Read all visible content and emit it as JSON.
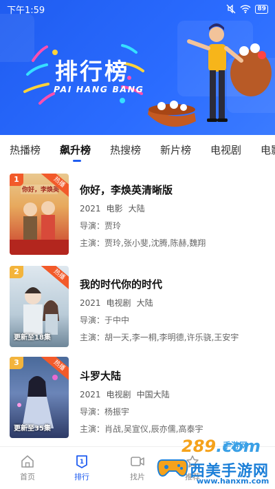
{
  "status_bar": {
    "time": "下午1:59",
    "battery": "89"
  },
  "banner": {
    "title": "排行榜",
    "subtitle": "PAI HANG BANG"
  },
  "tabs": [
    {
      "label": "热播榜"
    },
    {
      "label": "飙升榜",
      "active": true
    },
    {
      "label": "热搜榜"
    },
    {
      "label": "新片榜"
    },
    {
      "label": "电视剧"
    },
    {
      "label": "电影"
    }
  ],
  "items": [
    {
      "rank": "1",
      "badge": "热播",
      "rank_color": "#f25a2a",
      "poster_text": "你好，李焕英",
      "title": "你好，李焕英清晰版",
      "year": "2021",
      "type": "电影",
      "region": "大陆",
      "director_label": "导演：",
      "director": "贾玲",
      "cast_label": "主演：",
      "cast": "贾玲,张小斐,沈腾,陈赫,魏翔"
    },
    {
      "rank": "2",
      "badge": "热播",
      "rank_color": "#f3b43c",
      "poster_text": "更新至18集",
      "title": "我的时代你的时代",
      "year": "2021",
      "type": "电视剧",
      "region": "大陆",
      "director_label": "导演：",
      "director": "于中中",
      "cast_label": "主演：",
      "cast": "胡一天,李一桐,李明德,许乐骁,王安宇"
    },
    {
      "rank": "3",
      "badge": "热播",
      "rank_color": "#f3b43c",
      "poster_text": "更新至35集",
      "title": "斗罗大陆",
      "year": "2021",
      "type": "电视剧",
      "region": "中国大陆",
      "director_label": "导演：",
      "director": "杨振宇",
      "cast_label": "主演：",
      "cast": "肖战,吴宣仪,辰亦儒,高泰宇"
    }
  ],
  "bottom_nav": [
    {
      "label": "首页",
      "icon": "home-icon"
    },
    {
      "label": "排行",
      "icon": "ranking-icon",
      "active": true
    },
    {
      "label": "找片",
      "icon": "video-icon"
    },
    {
      "label": "推荐",
      "icon": "recommend-icon"
    }
  ],
  "watermark": {
    "brand": "289",
    "domain_suffix": ".com",
    "tag": "手游网",
    "name": "西美手游网",
    "url": "www.hanxm.com"
  },
  "colors": {
    "primary": "#1f5cf0",
    "hot": "#f25a2a",
    "rank_other": "#f3b43c"
  }
}
